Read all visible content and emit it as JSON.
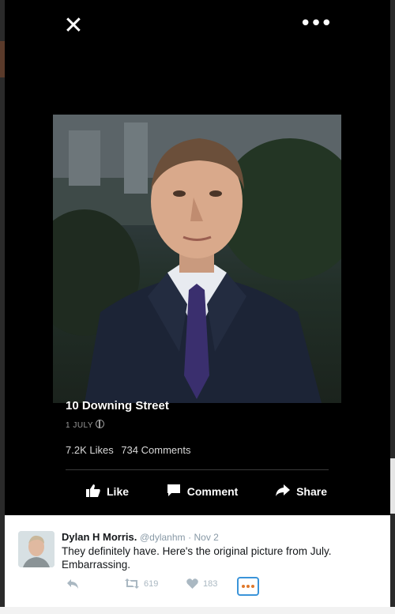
{
  "viewer": {
    "close_icon": "close-icon",
    "more_icon": "more-horizontal-icon"
  },
  "post": {
    "title": "10 Downing Street",
    "date": "1 JULY",
    "likes": "7.2K Likes",
    "comments": "734 Comments",
    "actions": {
      "like_label": "Like",
      "comment_label": "Comment",
      "share_label": "Share"
    }
  },
  "tweet": {
    "name": "Dylan H Morris.",
    "handle": "@dylanhm",
    "time": "· Nov 2",
    "text": "They definitely have. Here's the original picture from July. Embarrassing.",
    "retweets": "619",
    "likes": "183"
  },
  "colors": {
    "viewer_bg": "#000000",
    "tweet_link": "#3b94d9",
    "more_dots": "#e0782a"
  }
}
